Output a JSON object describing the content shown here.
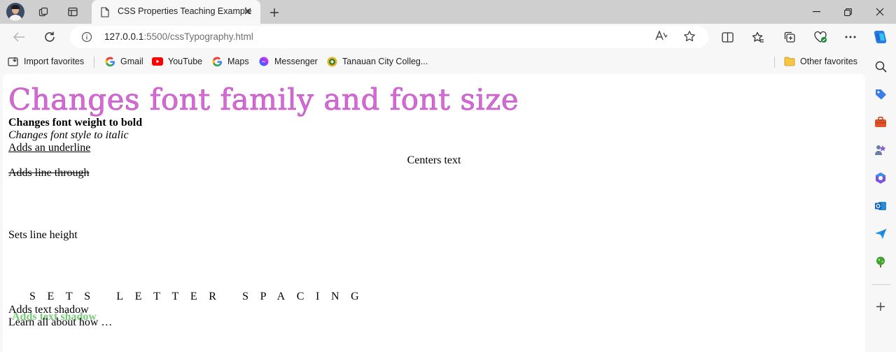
{
  "browser": {
    "tab": {
      "title": "CSS Properties Teaching Example"
    },
    "address": {
      "host": "127.0.0.1",
      "path": ":5500/cssTypography.html"
    },
    "read_aloud": "Aᴬ",
    "favorites": [
      {
        "label": "Import favorites",
        "icon": "import-icon"
      },
      {
        "label": "Gmail",
        "icon": "google-icon"
      },
      {
        "label": "YouTube",
        "icon": "youtube-icon"
      },
      {
        "label": "Maps",
        "icon": "google-icon"
      },
      {
        "label": "Messenger",
        "icon": "messenger-icon"
      },
      {
        "label": "Tanauan City Colleg...",
        "icon": "college-icon"
      }
    ],
    "other_favorites": "Other favorites"
  },
  "page": {
    "font_family_size": "Changes font family and font size",
    "bold": "Changes font weight to bold",
    "italic": "Changes font style to italic",
    "underline": "Adds an underline",
    "center": "Centers text",
    "line_through": "Adds line through",
    "line_height": "Sets line height",
    "letter_spacing": "Sets letter spacing",
    "text_shadow": "Adds text shadow",
    "learn": "Learn all about how …"
  },
  "colors": {
    "heading_pink": "#d56ad6",
    "shadow_green": "#79c97a",
    "accent_blue": "#0078d4"
  }
}
